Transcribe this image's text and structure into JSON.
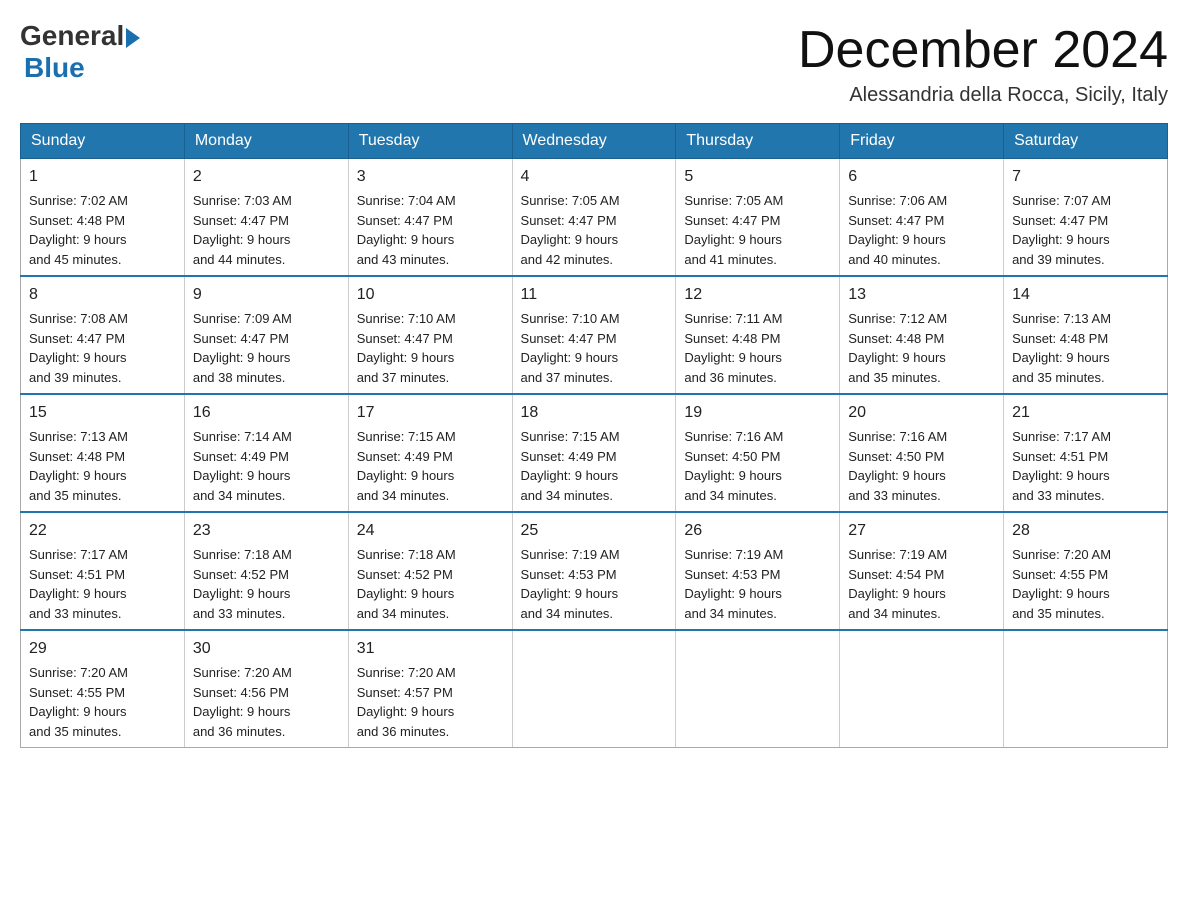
{
  "logo": {
    "general": "General",
    "blue": "Blue"
  },
  "title": "December 2024",
  "location": "Alessandria della Rocca, Sicily, Italy",
  "days_of_week": [
    "Sunday",
    "Monday",
    "Tuesday",
    "Wednesday",
    "Thursday",
    "Friday",
    "Saturday"
  ],
  "weeks": [
    [
      {
        "day": "1",
        "sunrise": "7:02 AM",
        "sunset": "4:48 PM",
        "daylight": "9 hours and 45 minutes."
      },
      {
        "day": "2",
        "sunrise": "7:03 AM",
        "sunset": "4:47 PM",
        "daylight": "9 hours and 44 minutes."
      },
      {
        "day": "3",
        "sunrise": "7:04 AM",
        "sunset": "4:47 PM",
        "daylight": "9 hours and 43 minutes."
      },
      {
        "day": "4",
        "sunrise": "7:05 AM",
        "sunset": "4:47 PM",
        "daylight": "9 hours and 42 minutes."
      },
      {
        "day": "5",
        "sunrise": "7:05 AM",
        "sunset": "4:47 PM",
        "daylight": "9 hours and 41 minutes."
      },
      {
        "day": "6",
        "sunrise": "7:06 AM",
        "sunset": "4:47 PM",
        "daylight": "9 hours and 40 minutes."
      },
      {
        "day": "7",
        "sunrise": "7:07 AM",
        "sunset": "4:47 PM",
        "daylight": "9 hours and 39 minutes."
      }
    ],
    [
      {
        "day": "8",
        "sunrise": "7:08 AM",
        "sunset": "4:47 PM",
        "daylight": "9 hours and 39 minutes."
      },
      {
        "day": "9",
        "sunrise": "7:09 AM",
        "sunset": "4:47 PM",
        "daylight": "9 hours and 38 minutes."
      },
      {
        "day": "10",
        "sunrise": "7:10 AM",
        "sunset": "4:47 PM",
        "daylight": "9 hours and 37 minutes."
      },
      {
        "day": "11",
        "sunrise": "7:10 AM",
        "sunset": "4:47 PM",
        "daylight": "9 hours and 37 minutes."
      },
      {
        "day": "12",
        "sunrise": "7:11 AM",
        "sunset": "4:48 PM",
        "daylight": "9 hours and 36 minutes."
      },
      {
        "day": "13",
        "sunrise": "7:12 AM",
        "sunset": "4:48 PM",
        "daylight": "9 hours and 35 minutes."
      },
      {
        "day": "14",
        "sunrise": "7:13 AM",
        "sunset": "4:48 PM",
        "daylight": "9 hours and 35 minutes."
      }
    ],
    [
      {
        "day": "15",
        "sunrise": "7:13 AM",
        "sunset": "4:48 PM",
        "daylight": "9 hours and 35 minutes."
      },
      {
        "day": "16",
        "sunrise": "7:14 AM",
        "sunset": "4:49 PM",
        "daylight": "9 hours and 34 minutes."
      },
      {
        "day": "17",
        "sunrise": "7:15 AM",
        "sunset": "4:49 PM",
        "daylight": "9 hours and 34 minutes."
      },
      {
        "day": "18",
        "sunrise": "7:15 AM",
        "sunset": "4:49 PM",
        "daylight": "9 hours and 34 minutes."
      },
      {
        "day": "19",
        "sunrise": "7:16 AM",
        "sunset": "4:50 PM",
        "daylight": "9 hours and 34 minutes."
      },
      {
        "day": "20",
        "sunrise": "7:16 AM",
        "sunset": "4:50 PM",
        "daylight": "9 hours and 33 minutes."
      },
      {
        "day": "21",
        "sunrise": "7:17 AM",
        "sunset": "4:51 PM",
        "daylight": "9 hours and 33 minutes."
      }
    ],
    [
      {
        "day": "22",
        "sunrise": "7:17 AM",
        "sunset": "4:51 PM",
        "daylight": "9 hours and 33 minutes."
      },
      {
        "day": "23",
        "sunrise": "7:18 AM",
        "sunset": "4:52 PM",
        "daylight": "9 hours and 33 minutes."
      },
      {
        "day": "24",
        "sunrise": "7:18 AM",
        "sunset": "4:52 PM",
        "daylight": "9 hours and 34 minutes."
      },
      {
        "day": "25",
        "sunrise": "7:19 AM",
        "sunset": "4:53 PM",
        "daylight": "9 hours and 34 minutes."
      },
      {
        "day": "26",
        "sunrise": "7:19 AM",
        "sunset": "4:53 PM",
        "daylight": "9 hours and 34 minutes."
      },
      {
        "day": "27",
        "sunrise": "7:19 AM",
        "sunset": "4:54 PM",
        "daylight": "9 hours and 34 minutes."
      },
      {
        "day": "28",
        "sunrise": "7:20 AM",
        "sunset": "4:55 PM",
        "daylight": "9 hours and 35 minutes."
      }
    ],
    [
      {
        "day": "29",
        "sunrise": "7:20 AM",
        "sunset": "4:55 PM",
        "daylight": "9 hours and 35 minutes."
      },
      {
        "day": "30",
        "sunrise": "7:20 AM",
        "sunset": "4:56 PM",
        "daylight": "9 hours and 36 minutes."
      },
      {
        "day": "31",
        "sunrise": "7:20 AM",
        "sunset": "4:57 PM",
        "daylight": "9 hours and 36 minutes."
      },
      null,
      null,
      null,
      null
    ]
  ],
  "labels": {
    "sunrise": "Sunrise:",
    "sunset": "Sunset:",
    "daylight": "Daylight:"
  }
}
